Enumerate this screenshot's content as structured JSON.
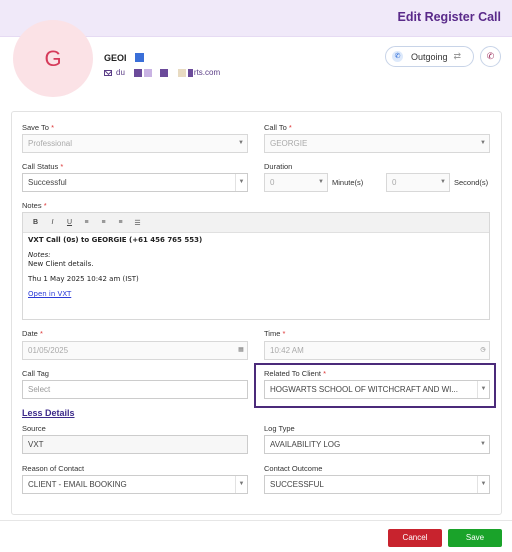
{
  "header": {
    "title": "Edit Register Call"
  },
  "contact": {
    "avatar_letter": "G",
    "name": "GEOI",
    "email_prefix": "du",
    "email_suffix": "rts.com"
  },
  "direction_button": {
    "label": "Outgoing"
  },
  "form": {
    "save_to": {
      "label": "Save To",
      "value": "Professional"
    },
    "call_to": {
      "label": "Call To",
      "value": "GEORGIE"
    },
    "call_status": {
      "label": "Call Status",
      "value": "Successful"
    },
    "duration": {
      "label": "Duration",
      "minutes_value": "0",
      "minutes_unit": "Minute(s)",
      "seconds_value": "0",
      "seconds_unit": "Second(s)"
    },
    "notes": {
      "label": "Notes",
      "toolbar": [
        "B",
        "I",
        "U",
        "≡",
        "≡",
        "≡",
        "☰"
      ],
      "line1": "VXT Call (0s) to GEORGIE (+61 456 765 553)",
      "notes_heading": "Notes:",
      "notes_text": "New Client details.",
      "timestamp": "Thu 1 May 2025 10:42 am (IST)",
      "link": "Open in VXT"
    },
    "date": {
      "label": "Date",
      "value": "01/05/2025"
    },
    "time": {
      "label": "Time",
      "value": "10:42 AM"
    },
    "call_tag": {
      "label": "Call Tag",
      "placeholder": "Select"
    },
    "related_to_client": {
      "label": "Related To Client",
      "value": "HOGWARTS SCHOOL OF WITCHCRAFT AND WI..."
    },
    "less_details": "Less Details",
    "source": {
      "label": "Source",
      "value": "VXT"
    },
    "log_type": {
      "label": "Log Type",
      "value": "AVAILABILITY LOG"
    },
    "reason_of_contact": {
      "label": "Reason of Contact",
      "value": "CLIENT - EMAIL BOOKING"
    },
    "contact_outcome": {
      "label": "Contact Outcome",
      "value": "SUCCESSFUL"
    }
  },
  "footer": {
    "cancel_label": "Cancel",
    "save_label": "Save"
  },
  "colors": {
    "accent": "#5a2a8a",
    "cancel": "#c8232e",
    "save": "#1aa32a"
  }
}
